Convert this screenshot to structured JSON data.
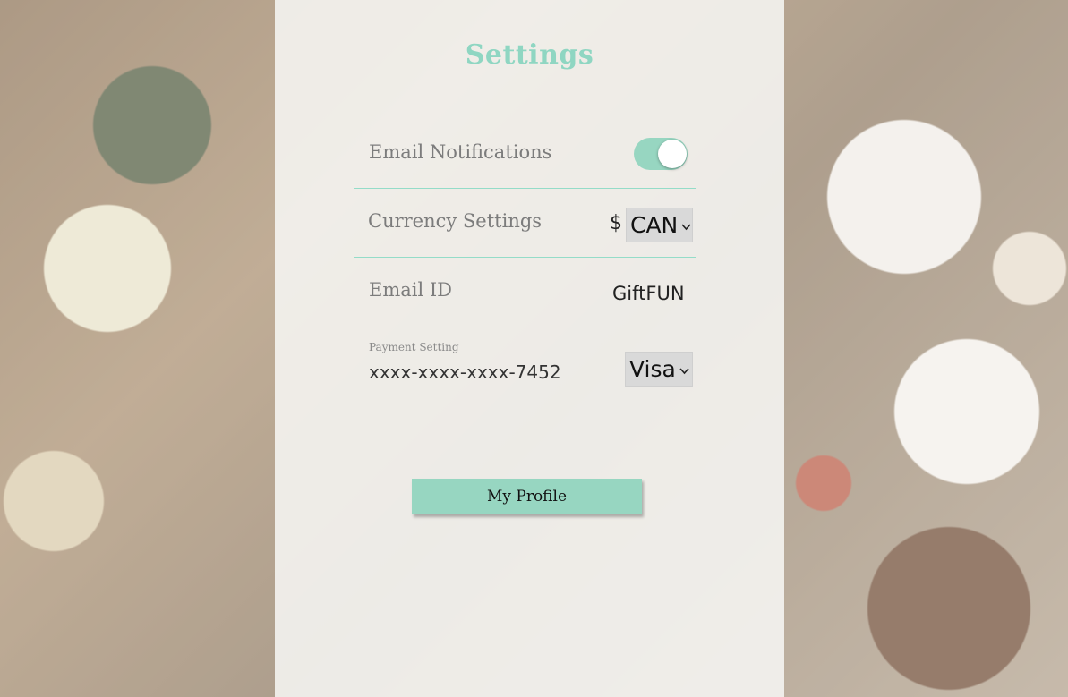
{
  "page": {
    "title": "Settings"
  },
  "settings": {
    "email_notifications": {
      "label": "Email Notifications",
      "enabled": true
    },
    "currency": {
      "label": "Currency Settings",
      "symbol": "$",
      "selected": "CAN"
    },
    "email_id": {
      "label": "Email ID",
      "value": "GiftFUN"
    },
    "payment": {
      "label": "Payment Setting",
      "card_number": "xxxx-xxxx-xxxx-7452",
      "card_type": "Visa"
    }
  },
  "actions": {
    "profile_label": "My Profile"
  },
  "colors": {
    "accent": "#97d6c1",
    "title": "#8fd6c2",
    "divider": "#94dcc8"
  },
  "icons": {
    "dropdown": "chevron-down-icon"
  }
}
